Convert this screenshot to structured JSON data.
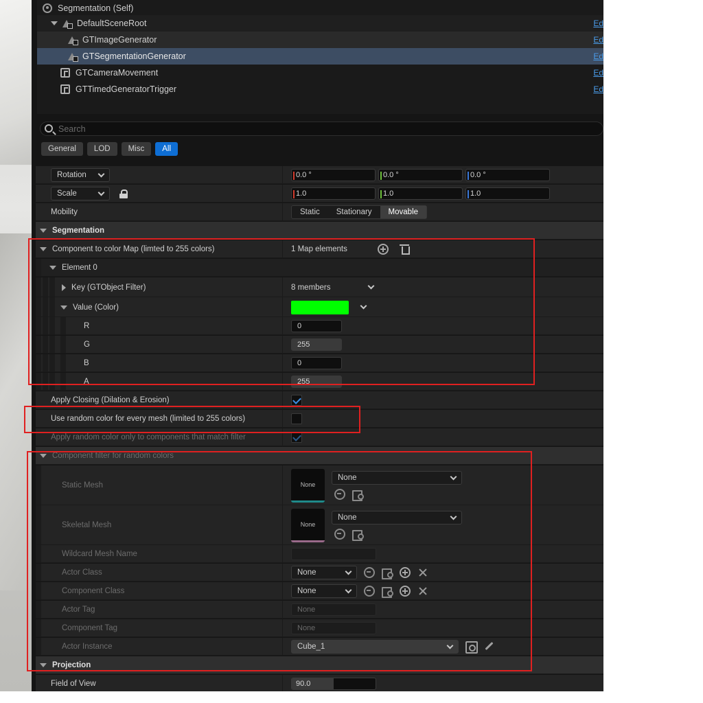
{
  "tree": {
    "root": "Segmentation (Self)",
    "scene_root": "DefaultSceneRoot",
    "image_gen": "GTImageGenerator",
    "seg_gen": "GTSegmentationGenerator",
    "camera": "GTCameraMovement",
    "trigger": "GTTimedGeneratorTrigger",
    "edit_link": "Ed"
  },
  "search": {
    "placeholder": "Search"
  },
  "tabs": [
    "General",
    "LOD",
    "Misc",
    "All"
  ],
  "transform": {
    "rotation_label": "Rotation",
    "rotation": [
      "0.0 °",
      "0.0 °",
      "0.0 °"
    ],
    "scale_label": "Scale",
    "scale": [
      "1.0",
      "1.0",
      "1.0"
    ],
    "mobility_label": "Mobility",
    "mobility_options": [
      "Static",
      "Stationary",
      "Movable"
    ],
    "mobility_selected": "Movable"
  },
  "segmentation": {
    "category": "Segmentation",
    "map_label": "Component to color Map (limted to 255 colors)",
    "map_count": "1 Map elements",
    "element": "Element 0",
    "key_label": "Key (GTObject Filter)",
    "key_value": "8 members",
    "value_label": "Value (Color)",
    "color": "#00ff00",
    "r_label": "R",
    "r": "0",
    "g_label": "G",
    "g": "255",
    "b_label": "B",
    "b": "0",
    "a_label": "A",
    "a": "255",
    "closing_label": "Apply Closing (Dilation & Erosion)",
    "closing": true,
    "random_label": "Use random color for every mesh (limited to 255 colors)",
    "random": false,
    "random_filter_label": "Apply random color only to components that match filter",
    "random_filter": true
  },
  "filter": {
    "category": "Component filter for random colors",
    "static_mesh_label": "Static Mesh",
    "static_mesh_thumb": "None",
    "static_mesh_value": "None",
    "skeletal_mesh_label": "Skeletal Mesh",
    "skeletal_mesh_thumb": "None",
    "skeletal_mesh_value": "None",
    "wildcard_label": "Wildcard Mesh Name",
    "wildcard_value": "",
    "actor_class_label": "Actor Class",
    "actor_class_value": "None",
    "component_class_label": "Component Class",
    "component_class_value": "None",
    "actor_tag_label": "Actor Tag",
    "actor_tag_placeholder": "None",
    "component_tag_label": "Component Tag",
    "component_tag_placeholder": "None",
    "actor_instance_label": "Actor Instance",
    "actor_instance_value": "Cube_1"
  },
  "projection": {
    "category": "Projection",
    "fov_label": "Field of View",
    "fov": "90.0",
    "fov_fraction": 0.5
  },
  "colors": {
    "accent": "#0e6ed4",
    "highlight": "#e02020",
    "selected_row": "#3d4d63",
    "swatch": "#00ff00"
  }
}
